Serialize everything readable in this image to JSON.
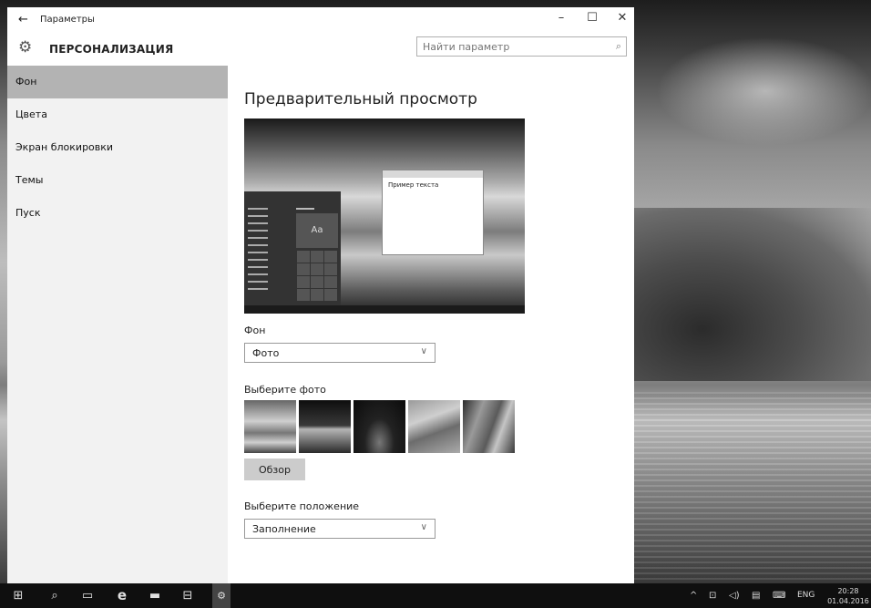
{
  "window": {
    "back_icon": "back-arrow-icon",
    "title": "Параметры",
    "controls": {
      "minimize": "–",
      "maximize": "☐",
      "close": "✕"
    }
  },
  "header": {
    "icon": "gear-icon",
    "title": "ПЕРСОНАЛИЗАЦИЯ",
    "search_placeholder": "Найти параметр",
    "search_icon": "search-icon"
  },
  "sidebar": {
    "items": [
      {
        "label": "Фон",
        "active": true
      },
      {
        "label": "Цвета",
        "active": false
      },
      {
        "label": "Экран блокировки",
        "active": false
      },
      {
        "label": "Темы",
        "active": false
      },
      {
        "label": "Пуск",
        "active": false
      }
    ]
  },
  "main": {
    "preview_title": "Предварительный просмотр",
    "preview": {
      "sample_text": "Пример текста",
      "tile_text": "Aa"
    },
    "background_label": "Фон",
    "background_value": "Фото",
    "choose_photo_label": "Выберите фото",
    "browse_button": "Обзор",
    "position_label": "Выберите положение",
    "position_value": "Заполнение"
  },
  "taskbar": {
    "tray_lang": "ENG",
    "time": "20:28",
    "date": "01.04.2016"
  }
}
